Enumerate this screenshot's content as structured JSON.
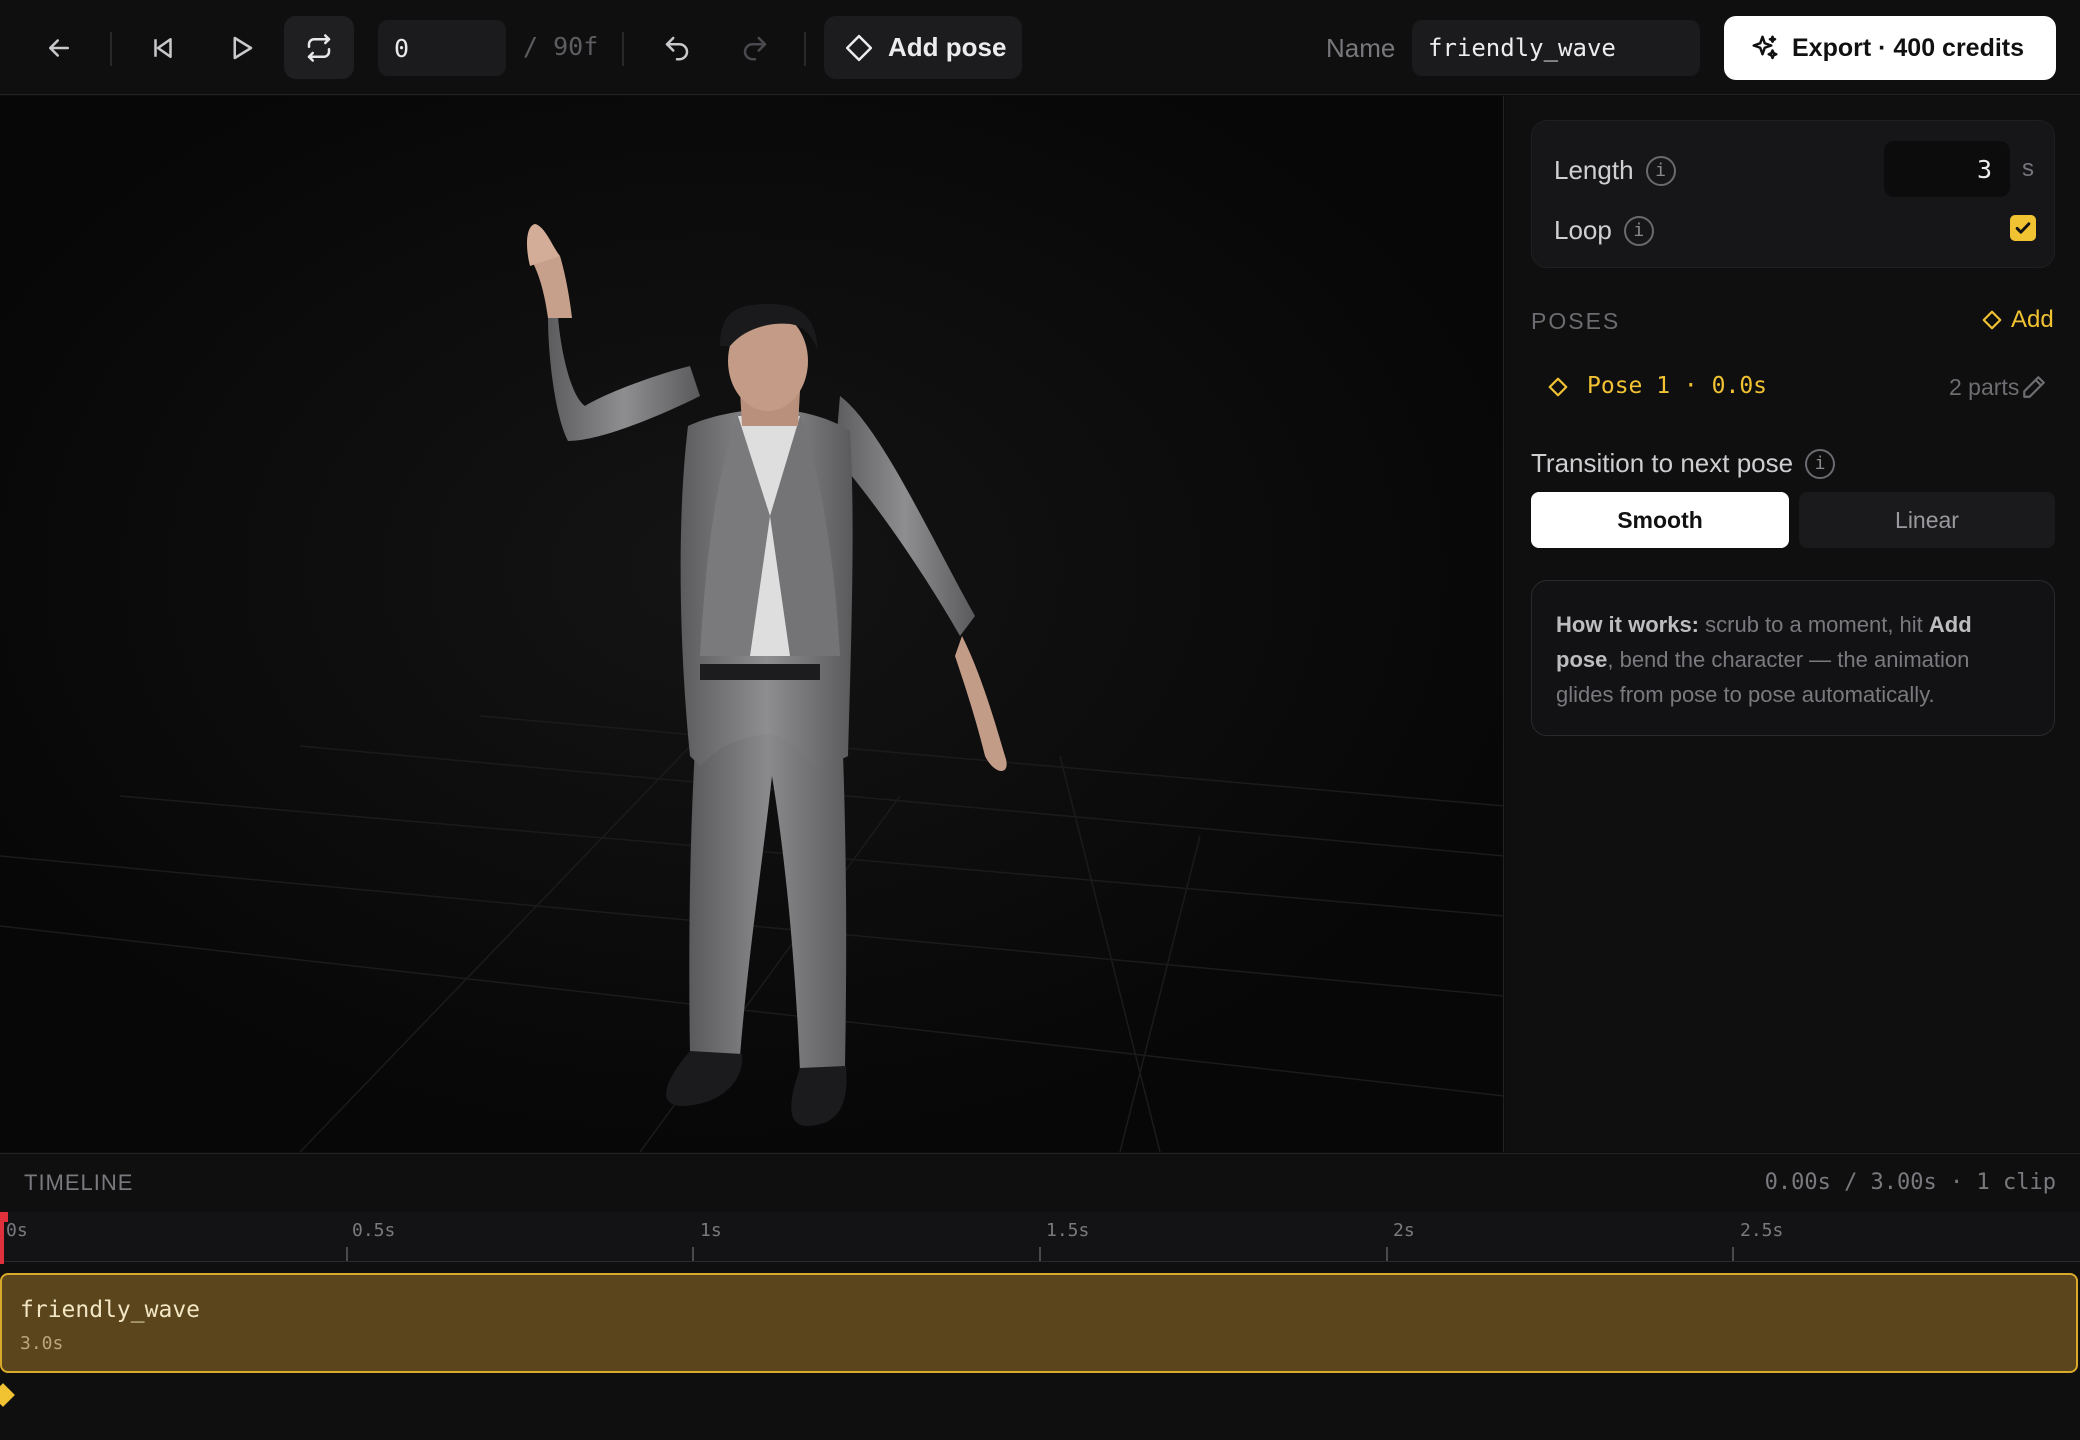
{
  "topbar": {
    "frame_value": "0",
    "frame_total": "/ 90f",
    "add_pose_label": "Add pose",
    "name_label": "Name",
    "name_value": "friendly_wave",
    "export_label": "Export · 400 credits",
    "icons": [
      "arrow-left-icon",
      "skip-back-icon",
      "play-icon",
      "loop-icon",
      "undo-icon",
      "redo-icon",
      "diamond-icon",
      "sparkles-icon"
    ]
  },
  "panel": {
    "length_label": "Length",
    "length_value": "3",
    "length_unit": "s",
    "loop_label": "Loop",
    "loop_checked": true,
    "poses_heading": "POSES",
    "poses_add": "Add",
    "poses": [
      {
        "label": "Pose 1 · 0.0s",
        "parts": "2 parts"
      }
    ],
    "transition_label": "Transition to next pose",
    "transition_options": [
      "Smooth",
      "Linear"
    ],
    "transition_selected": "Smooth",
    "howto_title": "How it works:",
    "howto_text_1": " scrub to a moment, hit ",
    "howto_bold": "Add pose",
    "howto_text_2": ", bend the character — the animation glides from pose to pose automatically."
  },
  "timeline": {
    "title": "TIMELINE",
    "info": "0.00s / 3.00s · 1 clip",
    "ticks": [
      "0s",
      "0.5s",
      "1s",
      "1.5s",
      "2s",
      "2.5s"
    ],
    "clip_name": "friendly_wave",
    "clip_length": "3.0s"
  },
  "colors": {
    "accent": "#f1c232",
    "clip_fill": "#5a451c",
    "clip_border": "#d9a92b",
    "playhead": "#e0303c"
  }
}
